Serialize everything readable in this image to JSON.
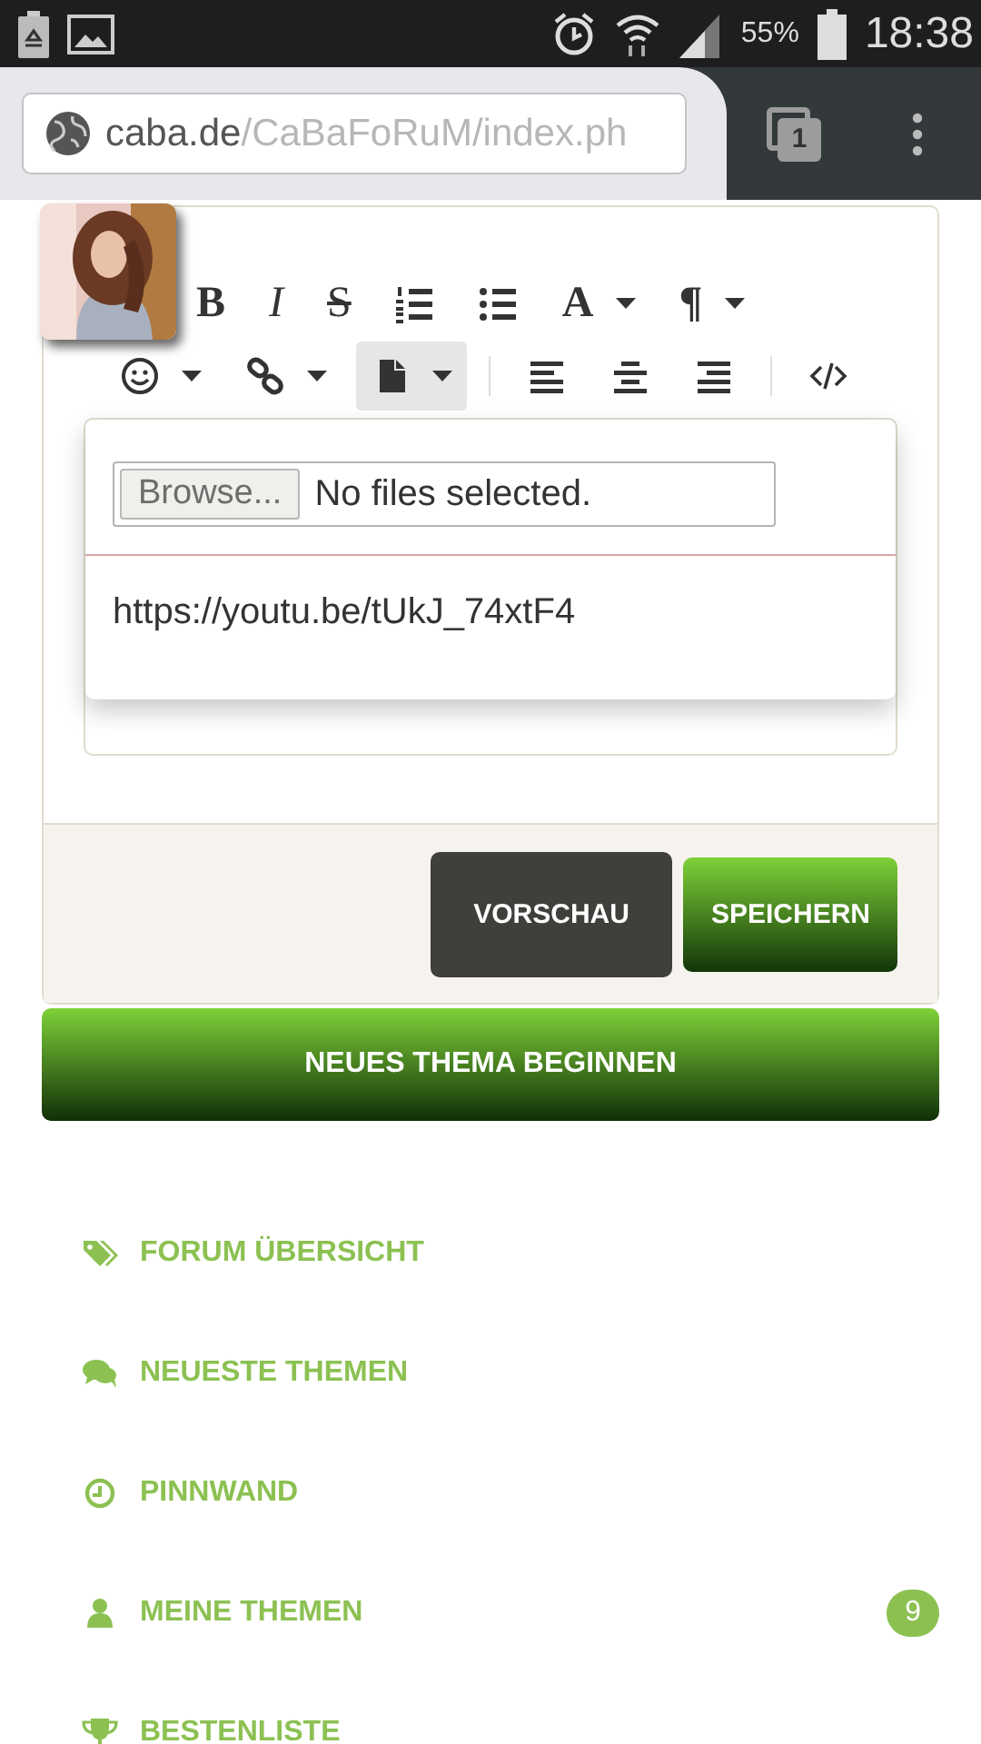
{
  "status_bar": {
    "battery": "55%",
    "time": "18:38"
  },
  "browser": {
    "url_host": "caba.de",
    "url_path": "/CaBaFoRuM/index.ph",
    "tab_count": "1"
  },
  "editor": {
    "toolbar": [
      [
        {
          "kind": "bold",
          "label": "B",
          "dropdown": false,
          "selected": false
        },
        {
          "kind": "italic",
          "label": "I",
          "dropdown": false,
          "selected": false
        },
        {
          "kind": "strike",
          "label": "S",
          "dropdown": false,
          "selected": false
        },
        {
          "kind": "ordered-list",
          "dropdown": false,
          "selected": false
        },
        {
          "kind": "bullet-list",
          "dropdown": false,
          "selected": false
        },
        {
          "kind": "font",
          "label": "A",
          "dropdown": true,
          "selected": false
        },
        {
          "kind": "paragraph",
          "label": "¶",
          "dropdown": true,
          "selected": false
        }
      ],
      [
        {
          "kind": "emoji",
          "dropdown": true,
          "selected": false
        },
        {
          "kind": "link",
          "dropdown": true,
          "selected": false
        },
        {
          "kind": "file",
          "dropdown": true,
          "selected": true
        },
        {
          "kind": "separator"
        },
        {
          "kind": "align-left",
          "dropdown": false,
          "selected": false
        },
        {
          "kind": "align-center",
          "dropdown": false,
          "selected": false
        },
        {
          "kind": "align-right",
          "dropdown": false,
          "selected": false
        },
        {
          "kind": "separator"
        },
        {
          "kind": "code",
          "dropdown": false,
          "selected": false
        }
      ]
    ],
    "popup": {
      "browse_button": "Browse...",
      "file_status": "No files selected.",
      "url_value": "https://youtu.be/tUkJ_74xtF4"
    },
    "buttons": [
      {
        "kind": "dark",
        "label": "VORSCHAU"
      },
      {
        "kind": "green",
        "label": "SPEICHERN"
      }
    ]
  },
  "new_topic_button": "NEUES THEMA BEGINNEN",
  "nav": [
    {
      "label": "FORUM ÜBERSICHT"
    },
    {
      "label": "NEUESTE THEMEN"
    },
    {
      "label": "PINNWAND"
    },
    {
      "label": "MEINE THEMEN",
      "badge": "9"
    },
    {
      "label": "BESTENLISTE"
    }
  ]
}
